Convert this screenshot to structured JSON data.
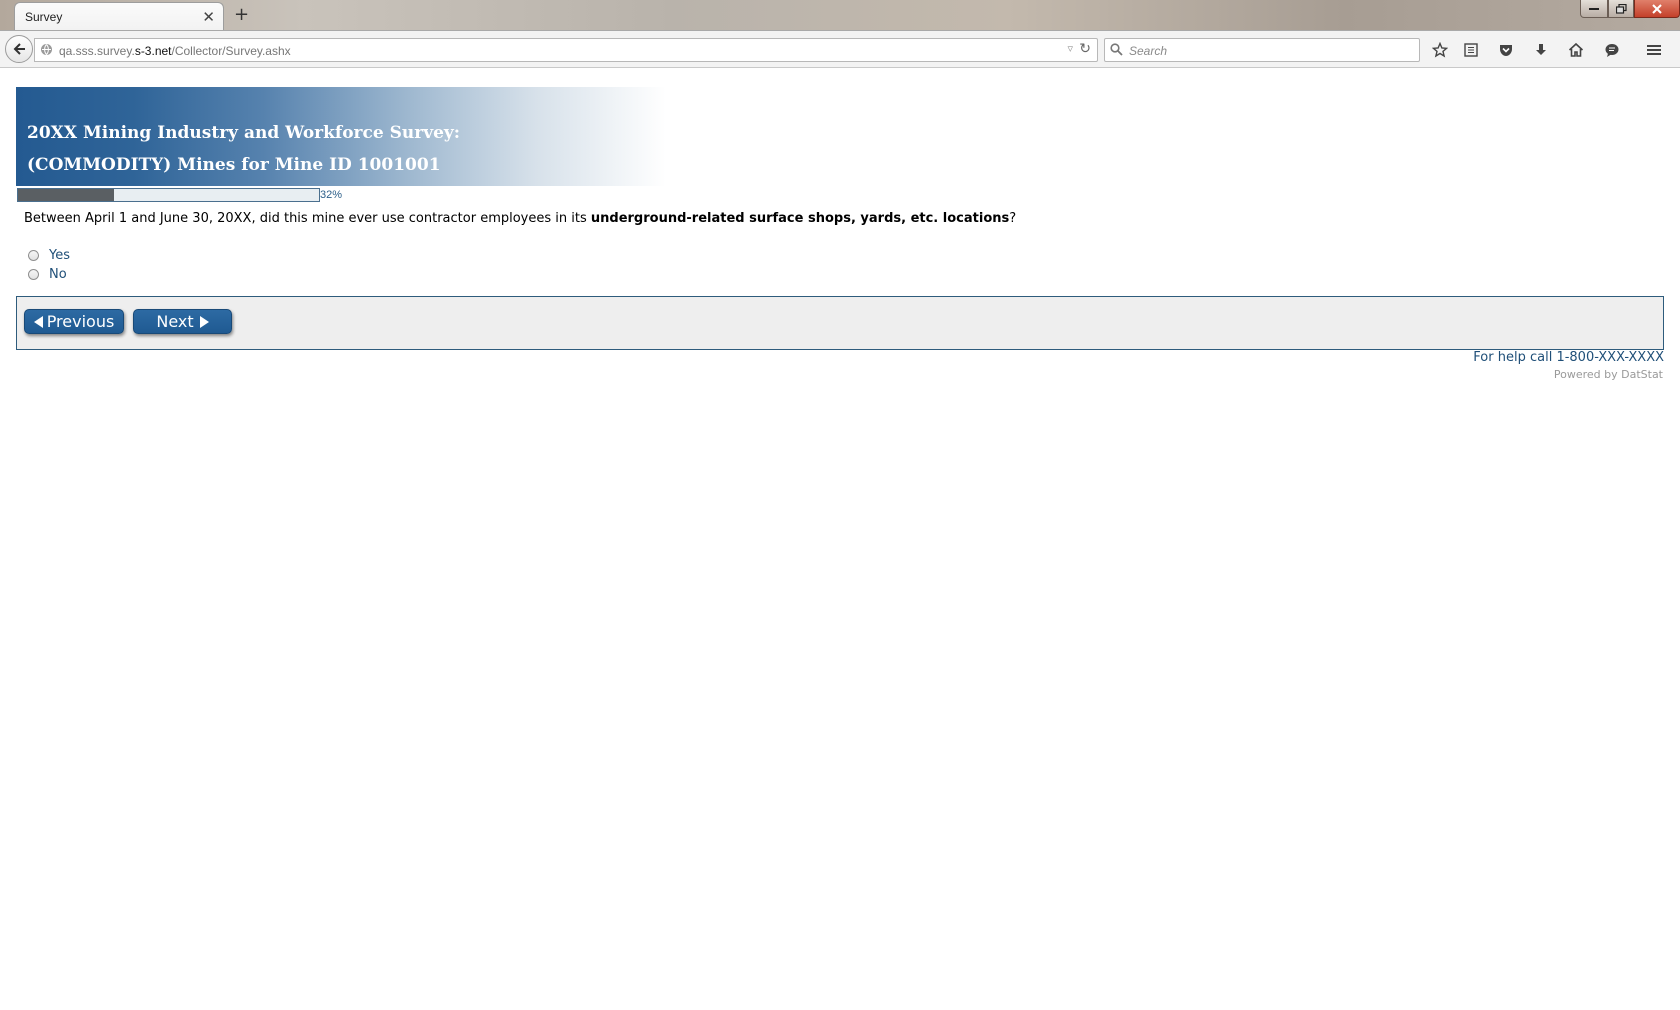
{
  "browser": {
    "tab_title": "Survey",
    "tab_close": "✕",
    "new_tab": "+",
    "url_host_prefix": "qa.sss.survey.",
    "url_domain": "s-3.net",
    "url_path": "/Collector/Survey.ashx",
    "search_placeholder": "Search"
  },
  "survey": {
    "title_line1": "20XX Mining Industry and Workforce Survey:",
    "title_line2": "(COMMODITY) Mines for Mine ID 1001001",
    "progress_percent": 32,
    "progress_label": "32%",
    "question_prefix": "Between April 1 and June 30, 20XX, did this mine ever use contractor employees in its ",
    "question_bold": "underground-related surface shops, yards, etc. locations",
    "question_suffix": "?",
    "options": [
      {
        "label": "Yes",
        "selected": false
      },
      {
        "label": "No",
        "selected": false
      }
    ],
    "previous_label": "Previous",
    "next_label": "Next",
    "help_text": "For help call 1-800-XXX-XXXX",
    "powered_by": "Powered by DatStat"
  },
  "colors": {
    "banner_blue": "#245a91",
    "button_blue": "#1f5a92",
    "link_blue": "#1f4f78",
    "progress_fill": "#5a5f63"
  }
}
